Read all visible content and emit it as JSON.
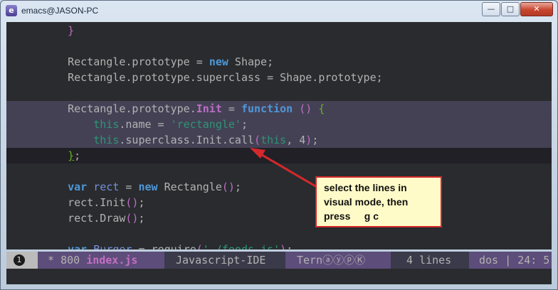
{
  "window": {
    "title": "emacs@JASON-PC",
    "app_icon": "emacs-icon",
    "controls": [
      "minimize",
      "maximize",
      "close"
    ]
  },
  "editor": {
    "lines": [
      {
        "indent": "    ",
        "tokens": [
          {
            "t": "}",
            "c": "brace2"
          }
        ]
      },
      {
        "indent": "",
        "tokens": []
      },
      {
        "indent": "    ",
        "tokens": [
          {
            "t": "Rectangle.prototype = ",
            "c": "cls"
          },
          {
            "t": "new",
            "c": "kw"
          },
          {
            "t": " Shape;",
            "c": "cls"
          }
        ]
      },
      {
        "indent": "    ",
        "tokens": [
          {
            "t": "Rectangle.prototype.superclass = Shape.prototype;",
            "c": "cls"
          }
        ]
      },
      {
        "indent": "",
        "tokens": []
      },
      {
        "indent": "    ",
        "hl": true,
        "tokens": [
          {
            "t": "Rectangle.prototype.",
            "c": "cls"
          },
          {
            "t": "Init",
            "c": "fn"
          },
          {
            "t": " = ",
            "c": "cls"
          },
          {
            "t": "function",
            "c": "kw"
          },
          {
            "t": " ",
            "c": "cls"
          },
          {
            "t": "()",
            "c": "brace2"
          },
          {
            "t": " ",
            "c": "cls"
          },
          {
            "t": "{",
            "c": "green"
          }
        ]
      },
      {
        "indent": "        ",
        "hl": true,
        "tokens": [
          {
            "t": "this",
            "c": "thisv"
          },
          {
            "t": ".name = ",
            "c": "cls"
          },
          {
            "t": "'rectangle'",
            "c": "str"
          },
          {
            "t": ";",
            "c": "cls"
          }
        ]
      },
      {
        "indent": "        ",
        "hl": true,
        "tokens": [
          {
            "t": "this",
            "c": "thisv"
          },
          {
            "t": ".superclass.Init.call",
            "c": "cls"
          },
          {
            "t": "(",
            "c": "brace2"
          },
          {
            "t": "this",
            "c": "thisv"
          },
          {
            "t": ", ",
            "c": "cls"
          },
          {
            "t": "4",
            "c": "cls"
          },
          {
            "t": ")",
            "c": "brace2"
          },
          {
            "t": ";",
            "c": "cls"
          }
        ]
      },
      {
        "indent": "    ",
        "cursor": true,
        "tokens": [
          {
            "t": "}",
            "c": "green uline"
          },
          {
            "t": ";",
            "c": "cls"
          }
        ]
      },
      {
        "indent": "",
        "tokens": []
      },
      {
        "indent": "    ",
        "tokens": [
          {
            "t": "var",
            "c": "kw"
          },
          {
            "t": " ",
            "c": "cls"
          },
          {
            "t": "rect",
            "c": "vname"
          },
          {
            "t": " = ",
            "c": "cls"
          },
          {
            "t": "new",
            "c": "kw"
          },
          {
            "t": " Rectangle",
            "c": "cls"
          },
          {
            "t": "()",
            "c": "brace2"
          },
          {
            "t": ";",
            "c": "cls"
          }
        ]
      },
      {
        "indent": "    ",
        "tokens": [
          {
            "t": "rect.Init",
            "c": "cls"
          },
          {
            "t": "()",
            "c": "brace2"
          },
          {
            "t": ";",
            "c": "cls"
          }
        ]
      },
      {
        "indent": "    ",
        "tokens": [
          {
            "t": "rect.Draw",
            "c": "cls"
          },
          {
            "t": "()",
            "c": "brace2"
          },
          {
            "t": ";",
            "c": "cls"
          }
        ]
      },
      {
        "indent": "",
        "tokens": []
      },
      {
        "indent": "    ",
        "tokens": [
          {
            "t": "var",
            "c": "kw"
          },
          {
            "t": " ",
            "c": "cls"
          },
          {
            "t": "Burger",
            "c": "vname"
          },
          {
            "t": " = require",
            "c": "cls"
          },
          {
            "t": "(",
            "c": "brace2"
          },
          {
            "t": "'./foods.js'",
            "c": "str"
          },
          {
            "t": ")",
            "c": "brace2"
          },
          {
            "t": ";",
            "c": "cls"
          }
        ]
      }
    ]
  },
  "callout": {
    "lines": [
      "select the lines in",
      "visual mode, then",
      "press     g c"
    ]
  },
  "modeline": {
    "window_number": "1",
    "modified_marker": "*",
    "buffer_size": "800",
    "filename": "index.js",
    "major_mode": "Javascript-IDE",
    "minor_mode": "TernⓐⓨⓟⓀ",
    "selection": "4 lines",
    "eol": "dos | 24: 5"
  },
  "colors": {
    "background": "#292b2e",
    "highlight": "#444155",
    "modeline_accent": "#5d4d7a",
    "callout_border": "#d3292c",
    "callout_fill": "#fffbc8"
  }
}
